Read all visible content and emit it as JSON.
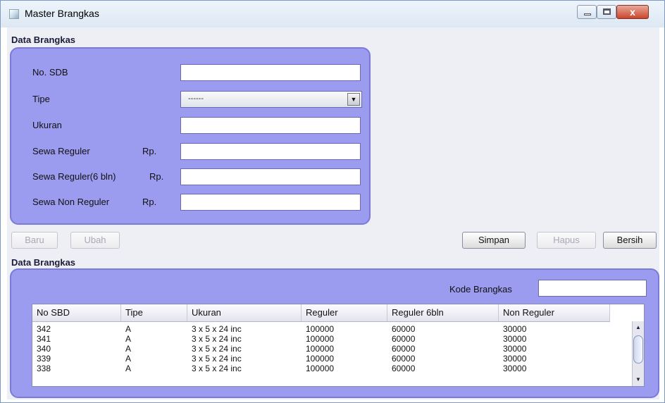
{
  "window": {
    "title": "Master Brangkas",
    "close_glyph": "x"
  },
  "form_panel": {
    "heading": "Data Brangkas",
    "fields": {
      "no_sdb": {
        "label": "No. SDB",
        "value": ""
      },
      "tipe": {
        "label": "Tipe",
        "selected": "------"
      },
      "ukuran": {
        "label": "Ukuran",
        "value": ""
      },
      "sewa_reguler": {
        "label": "Sewa Reguler",
        "prefix": "Rp.",
        "value": ""
      },
      "sewa_reguler6": {
        "label": "Sewa Reguler(6 bln)",
        "prefix": "Rp.",
        "value": ""
      },
      "sewa_non_reguler": {
        "label": "Sewa Non Reguler",
        "prefix": "Rp.",
        "value": ""
      }
    }
  },
  "buttons": {
    "baru": "Baru",
    "ubah": "Ubah",
    "simpan": "Simpan",
    "hapus": "Hapus",
    "bersih": "Bersih"
  },
  "table_panel": {
    "heading": "Data Brangkas",
    "search_label": "Kode Brangkas",
    "search_value": "",
    "columns": [
      "No SBD",
      "Tipe",
      "Ukuran",
      "Reguler",
      "Reguler 6bln",
      "Non Reguler"
    ],
    "rows": [
      [
        "342",
        "A",
        "3 x 5 x 24 inc",
        "100000",
        "60000",
        "30000"
      ],
      [
        "341",
        "A",
        "3 x 5 x 24 inc",
        "100000",
        "60000",
        "30000"
      ],
      [
        "340",
        "A",
        "3 x 5 x 24 inc",
        "100000",
        "60000",
        "30000"
      ],
      [
        "339",
        "A",
        "3 x 5 x 24 inc",
        "100000",
        "60000",
        "30000"
      ],
      [
        "338",
        "A",
        "3 x 5 x 24 inc",
        "100000",
        "60000",
        "30000"
      ]
    ]
  },
  "icons": {
    "app": "app-icon",
    "minimize": "minimize-icon",
    "maximize": "maximize-icon",
    "close": "close-icon",
    "dropdown": "chevron-down-icon",
    "scroll_up": "arrow-up-icon",
    "scroll_down": "arrow-down-icon"
  }
}
